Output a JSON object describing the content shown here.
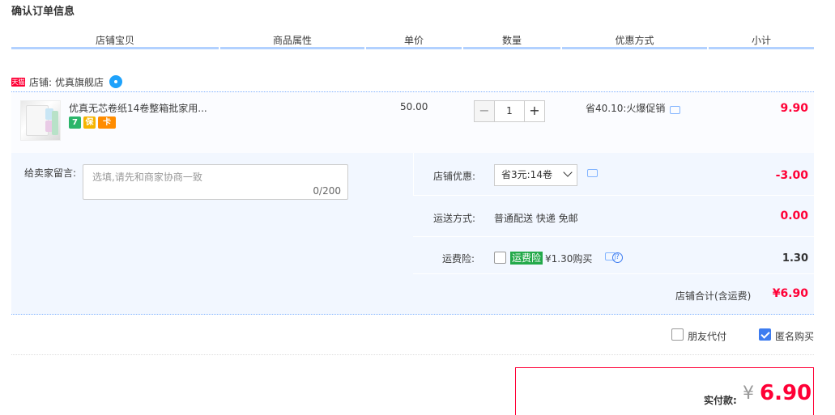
{
  "title": "确认订单信息",
  "columns": [
    "店铺宝贝",
    "商品属性",
    "单价",
    "数量",
    "优惠方式",
    "小计"
  ],
  "shop": {
    "tag": "天猫",
    "label": "店铺:",
    "name": "优真旗舰店"
  },
  "item": {
    "name": "优真无芯卷纸14卷整箱批家用...",
    "badges": [
      "7",
      "保",
      "卡"
    ],
    "price": "50.00",
    "qty": "1",
    "qty_minus": "−",
    "qty_plus": "+",
    "promo": "省40.10:火爆促销",
    "subtotal": "9.90"
  },
  "message": {
    "label": "给卖家留言:",
    "placeholder": "选填,请先和商家协商一致",
    "count": "0/200"
  },
  "discount": {
    "label": "店铺优惠:",
    "selected": "省3元:14卷",
    "value": "-3.00"
  },
  "shipping": {
    "label": "运送方式:",
    "text": "普通配送 快递 免邮",
    "value": "0.00"
  },
  "insurance": {
    "label": "运费险:",
    "tag": "运费险",
    "text": "¥1.30购买",
    "help": "?",
    "value": "1.30"
  },
  "shop_total": {
    "label": "店铺合计(含运费)",
    "value": "¥6.90"
  },
  "options": {
    "friend_pay": "朋友代付",
    "anonymous": "匿名购买",
    "anonymous_checked": true
  },
  "pay": {
    "label": "实付款:",
    "currency": "¥",
    "amount": "6.90"
  },
  "colors": {
    "accent_red": "#ff0036",
    "accent_blue": "#3d7cf0",
    "panel_bg": "#f2f7ff"
  }
}
